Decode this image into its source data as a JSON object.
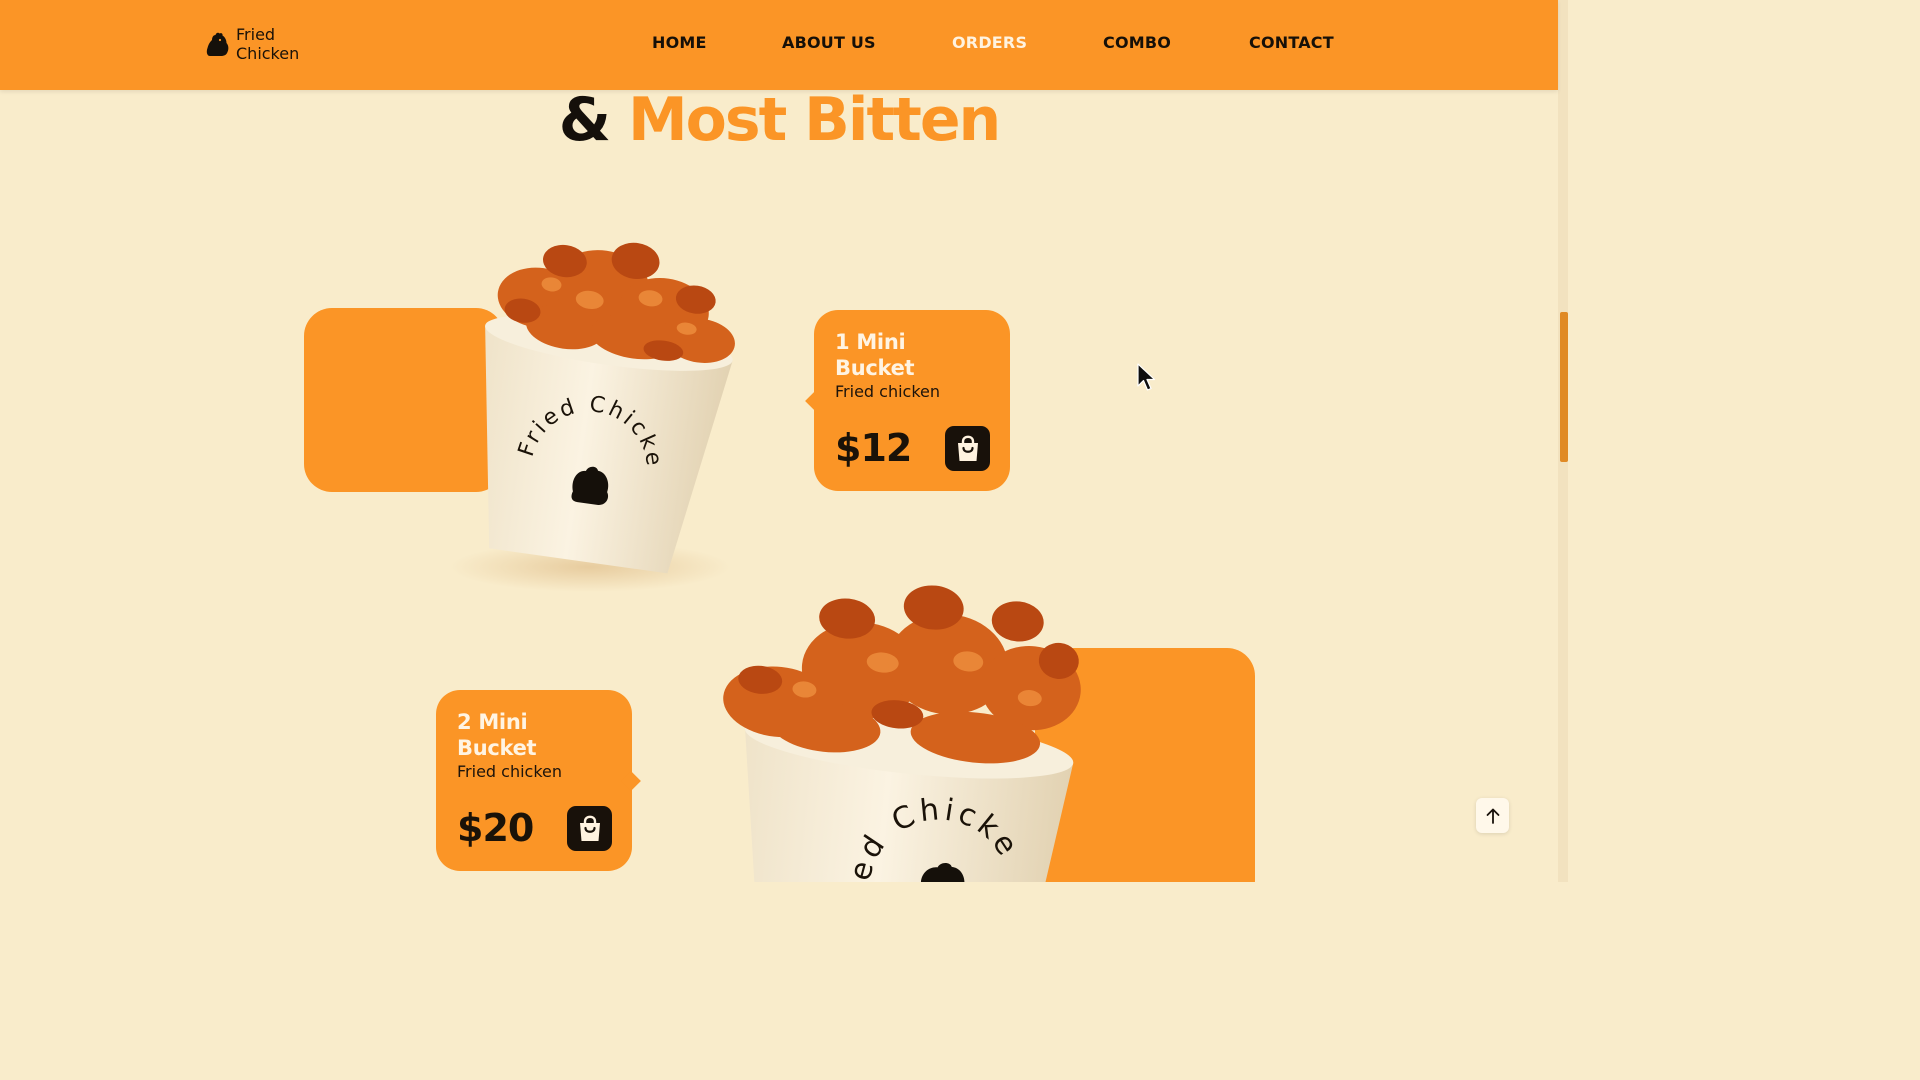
{
  "brand": {
    "name_line1": "Fried",
    "name_line2": "Chicken",
    "icon": "chicken-logo-icon"
  },
  "nav": {
    "items": [
      {
        "label": "HOME",
        "active": false
      },
      {
        "label": "ABOUT US",
        "active": false
      },
      {
        "label": "ORDERS",
        "active": true
      },
      {
        "label": "COMBO",
        "active": false
      },
      {
        "label": "CONTACT",
        "active": false
      }
    ]
  },
  "section": {
    "heading_prefix": "&",
    "heading_accent": "Most Bitten"
  },
  "products": [
    {
      "title": "1 Mini Bucket",
      "subtitle": "Fried chicken",
      "price": "$12",
      "bucket_print": "Fried Chicken",
      "cart_icon": "shopping-bag-icon"
    },
    {
      "title": "2 Mini Bucket",
      "subtitle": "Fried chicken",
      "price": "$20",
      "bucket_print": "Fried Chicken",
      "cart_icon": "shopping-bag-icon"
    }
  ],
  "scroll_top": {
    "icon": "arrow-up-icon"
  },
  "colors": {
    "accent": "#fb9526",
    "background": "#f9eccb",
    "dark": "#18110a"
  }
}
